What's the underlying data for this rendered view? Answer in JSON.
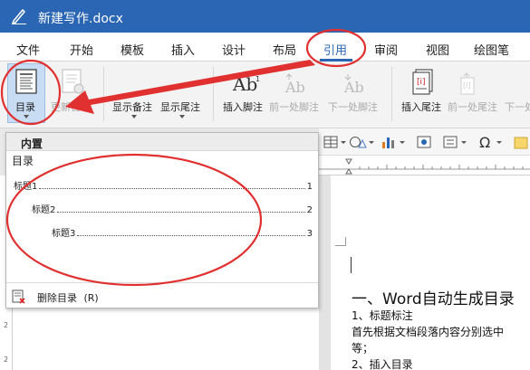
{
  "window": {
    "title": "新建写作.docx"
  },
  "tabs": [
    {
      "label": "文件",
      "active": false
    },
    {
      "label": "开始",
      "active": false
    },
    {
      "label": "模板",
      "active": false
    },
    {
      "label": "插入",
      "active": false
    },
    {
      "label": "设计",
      "active": false
    },
    {
      "label": "布局",
      "active": false
    },
    {
      "label": "引用",
      "active": true
    },
    {
      "label": "审阅",
      "active": false
    },
    {
      "label": "视图",
      "active": false
    },
    {
      "label": "绘图笔",
      "active": false
    }
  ],
  "ribbon": {
    "toc_label": "目录",
    "update_toc_label": "更新目录",
    "show_notes_label": "显示备注",
    "show_endnotes_label": "显示尾注",
    "insert_footnote_label": "插入脚注",
    "prev_footnote_label": "前一处脚注",
    "next_footnote_label": "下一处脚注",
    "insert_endnote_label": "插入尾注",
    "prev_endnote_label": "前一处尾注",
    "next_endnote_label": "下一处"
  },
  "dropdown": {
    "section_header": "内置",
    "toc_title": "目录",
    "entries": [
      {
        "label": "标题1",
        "page": "1"
      },
      {
        "label": "标题2",
        "page": "2"
      },
      {
        "label": "标题3",
        "page": "3"
      }
    ],
    "delete_label": "删除目录",
    "delete_shortcut": "(R)"
  },
  "document": {
    "heading": "一、Word自动生成目录",
    "line1": "1、标题标注",
    "line2": "首先根据文档段落内容分别选中",
    "line3": "等；",
    "line4": "2、插入目录"
  },
  "colors": {
    "title_bar": "#2b66b4",
    "annotation_red": "#e03030",
    "accent": "#2b66b4"
  }
}
